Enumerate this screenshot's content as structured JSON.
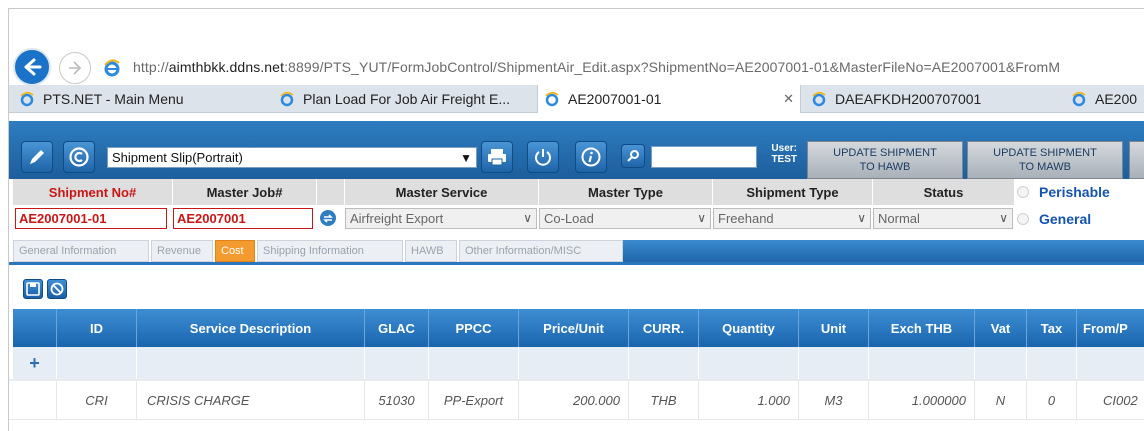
{
  "browser": {
    "url_prefix": "http://",
    "url_host": "aimthbkk.ddns.net",
    "url_rest": ":8899/PTS_YUT/FormJobControl/ShipmentAir_Edit.aspx?ShipmentNo=AE2007001-01&MasterFileNo=AE2007001&FromM",
    "tabs": [
      {
        "label": "PTS.NET - Main Menu"
      },
      {
        "label": "Plan Load For Job Air Freight E..."
      },
      {
        "label": "AE2007001-01"
      },
      {
        "label": "DAEAFKDH200707001"
      },
      {
        "label": "AE200"
      }
    ],
    "close_glyph": "✕"
  },
  "toolbar": {
    "report_select": "Shipment Slip(Portrait)",
    "user_label": "User:",
    "user_name": "TEST",
    "update_hawb_line1": "UPDATE SHIPMENT",
    "update_hawb_line2": "TO HAWB",
    "update_mawb_line1": "UPDATE SHIPMENT",
    "update_mawb_line2": "TO MAWB"
  },
  "header": {
    "shipment_no_label": "Shipment No#",
    "master_job_label": "Master Job#",
    "master_service_label": "Master Service",
    "master_type_label": "Master Type",
    "shipment_type_label": "Shipment Type",
    "status_label": "Status",
    "perishable_label": "Perishable",
    "general_label": "General",
    "shipment_no": "AE2007001-01",
    "master_job": "AE2007001",
    "master_service": "Airfreight Export",
    "master_type": "Co-Load",
    "shipment_type": "Freehand",
    "status": "Normal"
  },
  "page_tabs": [
    {
      "label": "General Information"
    },
    {
      "label": "Revenue"
    },
    {
      "label": "Cost"
    },
    {
      "label": "Shipping Information"
    },
    {
      "label": "HAWB"
    },
    {
      "label": "Other Information/MISC"
    }
  ],
  "active_page_tab": "Cost",
  "table": {
    "columns": [
      "ID",
      "Service Description",
      "GLAC",
      "PPCC",
      "Price/Unit",
      "CURR.",
      "Quantity",
      "Unit",
      "Exch THB",
      "Vat",
      "Tax",
      "From/P"
    ],
    "add_glyph": "+",
    "rows": [
      {
        "id": "CRI",
        "desc": "CRISIS CHARGE",
        "glac": "51030",
        "ppcc": "PP-Export",
        "price": "200.000",
        "curr": "THB",
        "qty": "1.000",
        "unit": "M3",
        "exch": "1.000000",
        "vat": "N",
        "tax": "0",
        "from": "CI002"
      }
    ]
  },
  "colors": {
    "accent": "#1d64a8",
    "active_tab": "#f39b2f",
    "required_label": "#c81717",
    "link_blue": "#1555b0"
  }
}
